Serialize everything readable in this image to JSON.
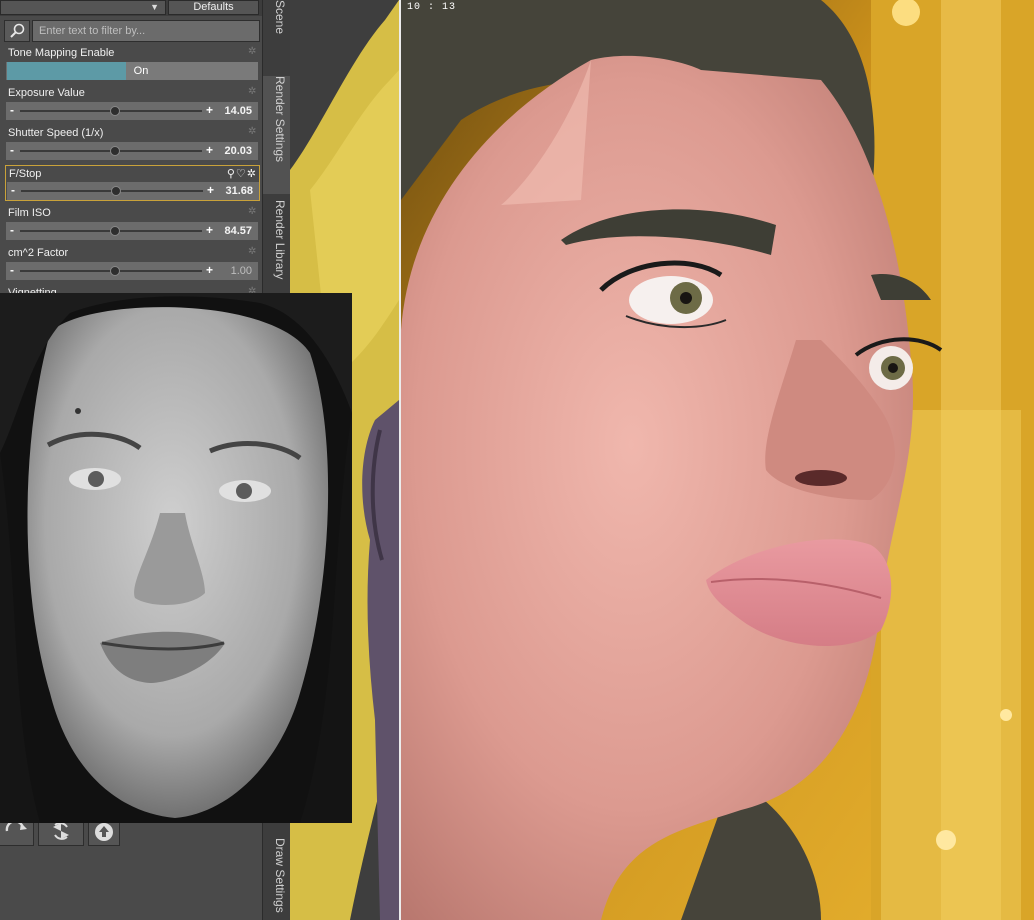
{
  "header": {
    "defaults_label": "Defaults",
    "filter_placeholder": "Enter text to filter by..."
  },
  "properties": [
    {
      "label": "Tone Mapping Enable",
      "value": "On"
    },
    {
      "label": "Exposure Value",
      "value": "14.05"
    },
    {
      "label": "Shutter Speed (1/x)",
      "value": "20.03"
    },
    {
      "label": "F/Stop",
      "value": "31.68"
    },
    {
      "label": "Film ISO",
      "value": "84.57"
    },
    {
      "label": "cm^2 Factor",
      "value": "1.00"
    },
    {
      "label": "Vignetting",
      "value": ""
    }
  ],
  "side_tabs": {
    "scene": "Scene",
    "render_settings": "Render Settings",
    "render_library": "Render Library",
    "draw_settings": "Draw Settings"
  },
  "viewport": {
    "time_readout": "10 : 13"
  },
  "colors": {
    "panel_bg": "#4a4a4a",
    "row_bg": "#6c6c6c",
    "toggle_accent": "#5d9aa6",
    "selection_border": "#c9a23a"
  },
  "icons": {
    "search": "magnifier-icon",
    "dropdown": "chevron-down-icon",
    "gear": "gear-icon",
    "link": "link-icon",
    "favorite": "heart-icon"
  }
}
